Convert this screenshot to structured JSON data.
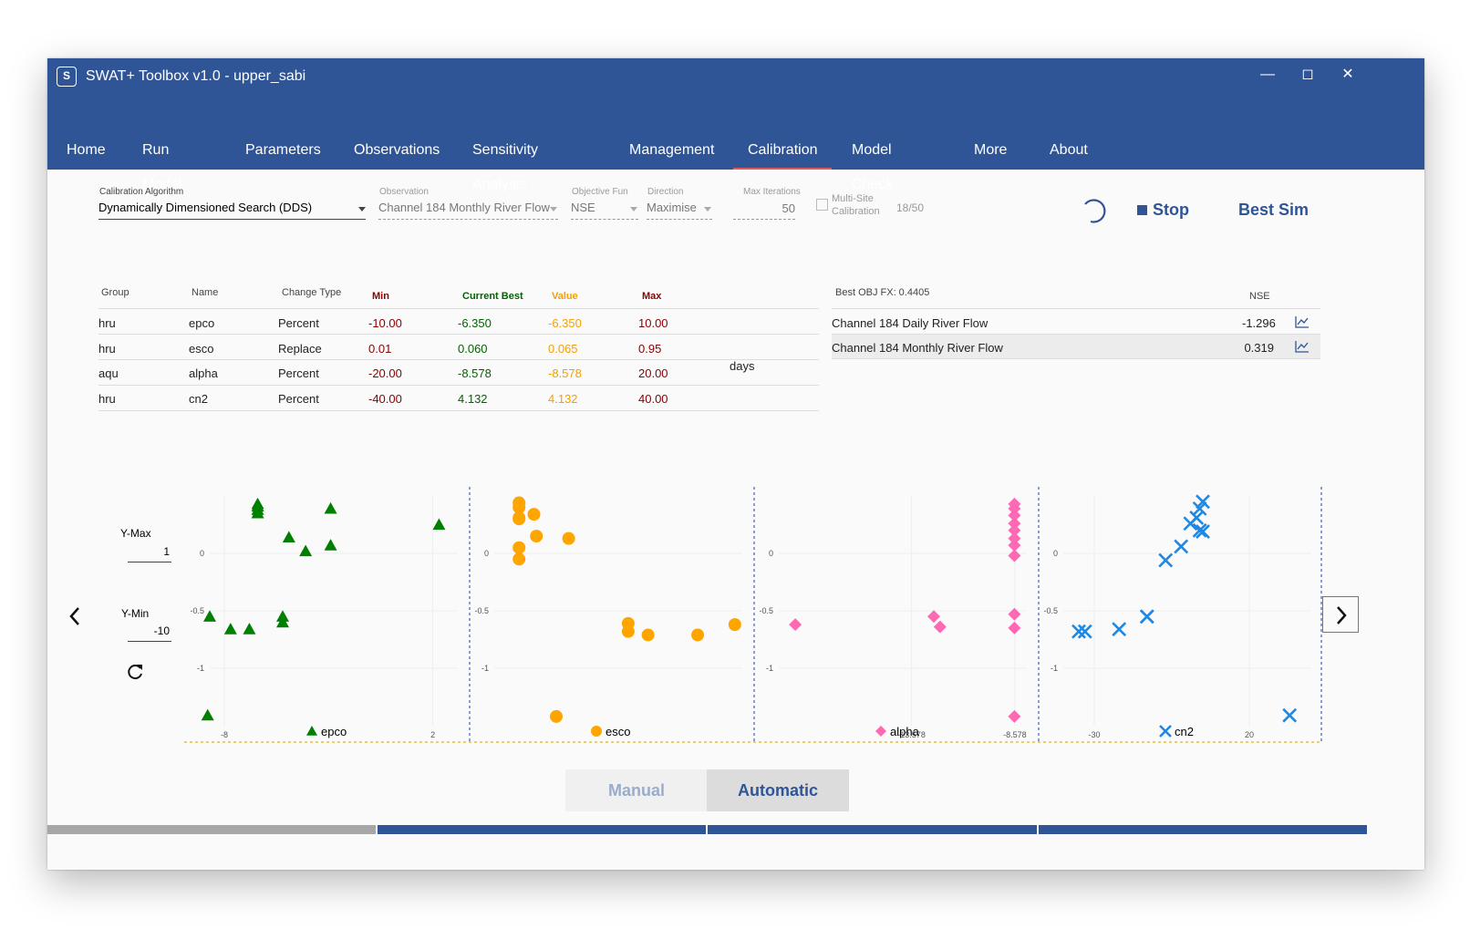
{
  "window": {
    "title": "SWAT+ Toolbox v1.0  -  upper_sabi",
    "icon": "swat-logo-icon",
    "controls": [
      "minimize-icon",
      "maximize-icon",
      "close-icon"
    ]
  },
  "nav": {
    "items": [
      "Home",
      "Run Model",
      "Parameters",
      "Observations",
      "Sensitivity Analysis",
      "Management",
      "Calibration",
      "Model Check",
      "More",
      "About"
    ],
    "active": "Calibration"
  },
  "config": {
    "algorithm_label": "Calibration Algorithm",
    "algorithm_value": "Dynamically Dimensioned Search (DDS)",
    "observation_label": "Observation",
    "observation_value": "Channel 184 Monthly River Flow",
    "objfun_label": "Objective Fun",
    "objfun_value": "NSE",
    "direction_label": "Direction",
    "direction_value": "Maximise",
    "maxiter_label": "Max Iterations",
    "maxiter_value": "50",
    "multisite_label_1": "Multi-Site",
    "multisite_label_2": "Calibration",
    "multisite_checked": false,
    "progress": "18/50"
  },
  "actions": {
    "stop_label": "Stop",
    "best_sim_label": "Best Sim",
    "spinner_icon": "loading-spinner-icon",
    "stop_icon": "stop-square-icon"
  },
  "params_table": {
    "headers": {
      "group": "Group",
      "name": "Name",
      "change_type": "Change Type",
      "min": "Min",
      "current_best": "Current Best",
      "value": "Value",
      "max": "Max"
    },
    "rows": [
      {
        "group": "hru",
        "name": "epco",
        "change_type": "Percent",
        "min": "-10.00",
        "current_best": "-6.350",
        "value": "-6.350",
        "max": "10.00"
      },
      {
        "group": "hru",
        "name": "esco",
        "change_type": "Replace",
        "min": "0.01",
        "current_best": "0.060",
        "value": "0.065",
        "max": "0.95"
      },
      {
        "group": "aqu",
        "name": "alpha",
        "change_type": "Percent",
        "min": "-20.00",
        "current_best": "-8.578",
        "value": "-8.578",
        "max": "20.00",
        "unit": "days"
      },
      {
        "group": "hru",
        "name": "cn2",
        "change_type": "Percent",
        "min": "-40.00",
        "current_best": "4.132",
        "value": "4.132",
        "max": "40.00"
      }
    ],
    "colors": {
      "min": "#8b0000",
      "current_best": "#006400",
      "value": "#f5a000",
      "max": "#8b0000"
    }
  },
  "obj_table": {
    "best_obj": "Best OBJ FX: 0.4405",
    "col": "NSE",
    "rows": [
      {
        "name": "Channel 184 Daily River Flow",
        "value": "-1.296",
        "icon": "line-chart-icon"
      },
      {
        "name": "Channel 184 Monthly River Flow",
        "value": "0.319",
        "icon": "line-chart-icon",
        "selected": true
      }
    ]
  },
  "yrange": {
    "max_label": "Y-Max",
    "max_value": "1",
    "min_label": "Y-Min",
    "min_value": "-10",
    "reset_icon": "refresh-icon"
  },
  "pager": {
    "prev_icon": "chevron-left-icon",
    "next_icon": "chevron-right-icon"
  },
  "chart_data": [
    {
      "type": "scatter",
      "name": "epco",
      "marker": "triangle",
      "color": "#008000",
      "xticks": [
        "-8",
        "2"
      ],
      "yticks": [
        "0",
        "-0.5",
        "-1"
      ],
      "xlim": [
        -8.7,
        3.2
      ],
      "ylim": [
        -1.5,
        0.5
      ],
      "x": [
        -6.4,
        -6.4,
        -6.4,
        -6.4,
        -4.9,
        -4.1,
        -2.9,
        -2.9,
        2.3,
        -8.7,
        -7.7,
        -6.8,
        -5.2,
        -5.2,
        -8.8
      ],
      "y": [
        0.43,
        0.41,
        0.38,
        0.35,
        0.14,
        0.02,
        0.07,
        0.39,
        0.25,
        -0.55,
        -0.66,
        -0.66,
        -0.55,
        -0.6,
        -1.41
      ]
    },
    {
      "type": "scatter",
      "name": "esco",
      "marker": "circle",
      "color": "#ffa500",
      "xticks": [],
      "yticks": [
        "0",
        "-0.5",
        "-1"
      ],
      "xlim": [
        0,
        1
      ],
      "ylim": [
        -1.5,
        0.5
      ],
      "x": [
        0.1,
        0.1,
        0.1,
        0.1,
        0.1,
        0.16,
        0.17,
        0.3,
        0.1,
        0.54,
        0.54,
        0.62,
        0.82,
        0.97,
        0.25
      ],
      "y": [
        0.44,
        0.4,
        0.3,
        0.31,
        0.05,
        0.34,
        0.15,
        0.13,
        -0.05,
        -0.61,
        -0.68,
        -0.71,
        -0.71,
        -0.62,
        -1.42
      ]
    },
    {
      "type": "scatter",
      "name": "alpha",
      "marker": "diamond",
      "color": "#ff69b4",
      "xticks": [
        "-13.578",
        "-8.578"
      ],
      "yticks": [
        "0",
        "-0.5",
        "-1"
      ],
      "xlim": [
        -20,
        -8
      ],
      "ylim": [
        -1.5,
        0.5
      ],
      "x": [
        -8.6,
        -8.6,
        -8.6,
        -8.6,
        -8.6,
        -8.6,
        -8.6,
        -8.6,
        -12.5,
        -12.2,
        -8.6,
        -8.6,
        -19.2,
        -8.6
      ],
      "y": [
        0.43,
        0.39,
        0.33,
        0.26,
        0.2,
        0.13,
        0.07,
        -0.02,
        -0.55,
        -0.64,
        -0.53,
        -0.65,
        -0.62,
        -1.42
      ]
    },
    {
      "type": "scatter",
      "name": "cn2",
      "marker": "x",
      "color": "#1e88e5",
      "xticks": [
        "-30",
        "20"
      ],
      "yticks": [
        "0",
        "-0.5",
        "-1"
      ],
      "xlim": [
        -40,
        40
      ],
      "ylim": [
        -1.5,
        0.5
      ],
      "x": [
        5,
        4,
        3,
        1,
        5,
        4,
        -2,
        -7,
        -13,
        -13,
        -22,
        -35,
        -33,
        33
      ],
      "y": [
        0.45,
        0.39,
        0.31,
        0.26,
        0.19,
        0.2,
        0.06,
        -0.06,
        -0.55,
        -0.55,
        -0.66,
        -0.68,
        -0.68,
        -1.41
      ]
    }
  ],
  "mode": {
    "manual_label": "Manual",
    "automatic_label": "Automatic",
    "active": "Automatic"
  }
}
